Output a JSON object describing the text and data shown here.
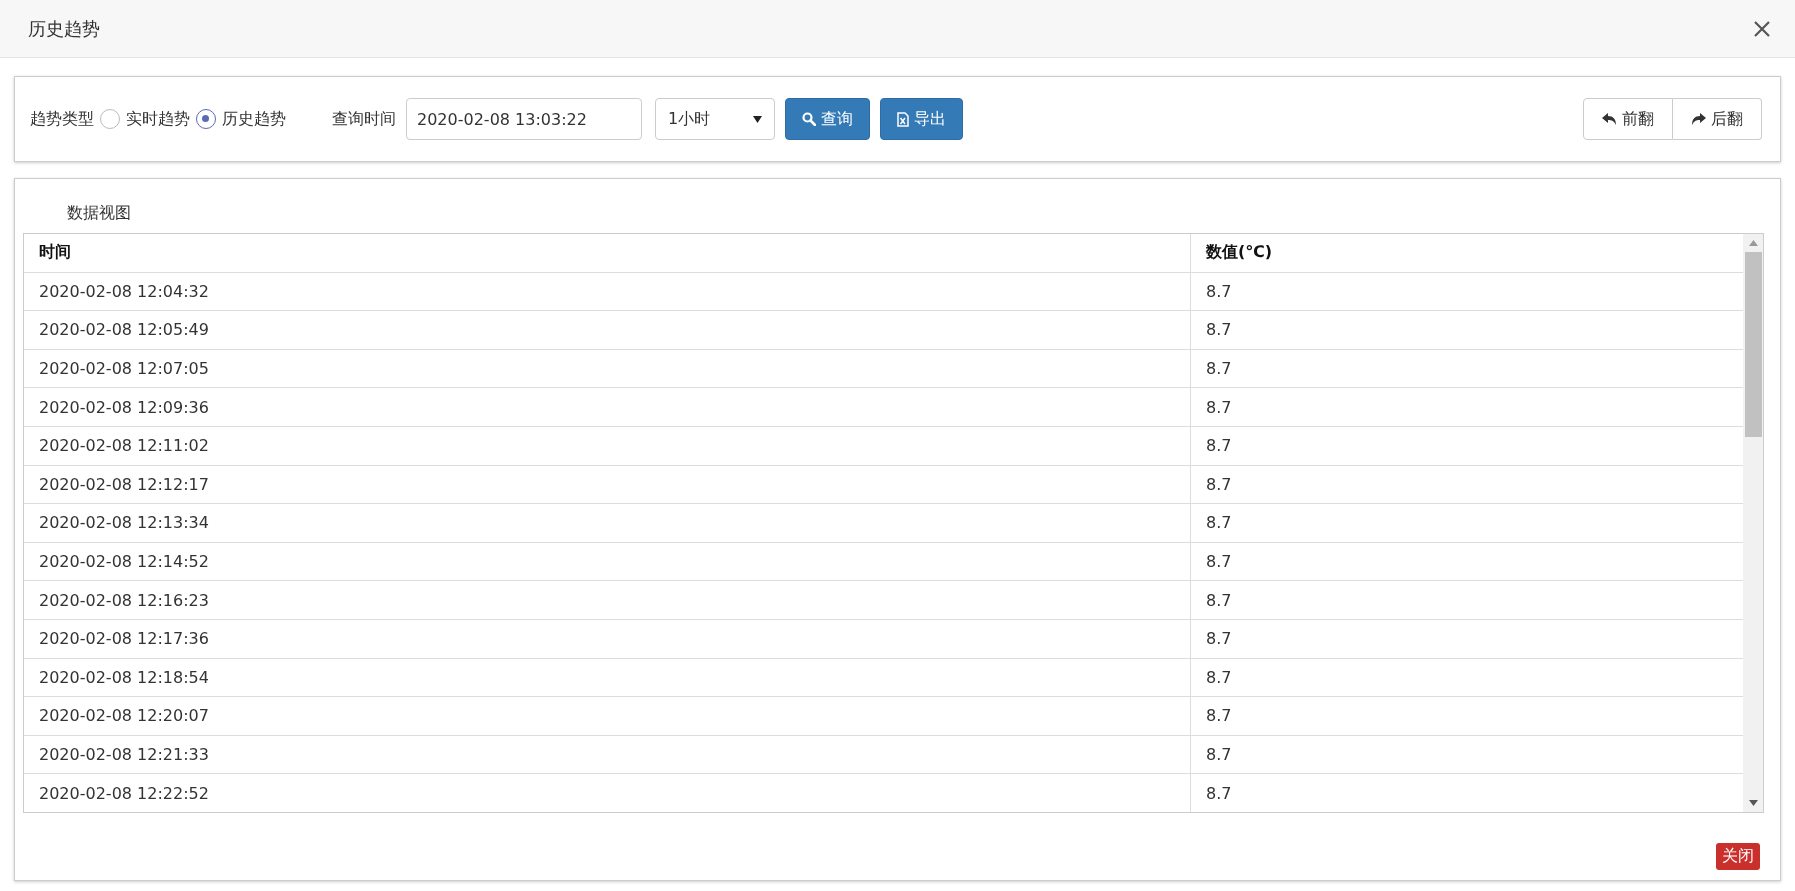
{
  "window": {
    "title": "历史趋势"
  },
  "toolbar": {
    "trend_type_label": "趋势类型",
    "trend_types": [
      {
        "label": "实时趋势",
        "selected": false
      },
      {
        "label": "历史趋势",
        "selected": true
      }
    ],
    "query_time_label": "查询时间",
    "query_time": "2020-02-08 13:03:22",
    "range": "1小时",
    "query_button": "查询",
    "export_button": "导出",
    "prev_button": "前翻",
    "next_button": "后翻"
  },
  "data_view": {
    "title": "数据视图",
    "columns": [
      "时间",
      "数值(℃)"
    ],
    "rows": [
      [
        "2020-02-08 12:04:32",
        "8.7"
      ],
      [
        "2020-02-08 12:05:49",
        "8.7"
      ],
      [
        "2020-02-08 12:07:05",
        "8.7"
      ],
      [
        "2020-02-08 12:09:36",
        "8.7"
      ],
      [
        "2020-02-08 12:11:02",
        "8.7"
      ],
      [
        "2020-02-08 12:12:17",
        "8.7"
      ],
      [
        "2020-02-08 12:13:34",
        "8.7"
      ],
      [
        "2020-02-08 12:14:52",
        "8.7"
      ],
      [
        "2020-02-08 12:16:23",
        "8.7"
      ],
      [
        "2020-02-08 12:17:36",
        "8.7"
      ],
      [
        "2020-02-08 12:18:54",
        "8.7"
      ],
      [
        "2020-02-08 12:20:07",
        "8.7"
      ],
      [
        "2020-02-08 12:21:33",
        "8.7"
      ],
      [
        "2020-02-08 12:22:52",
        "8.7"
      ]
    ]
  },
  "close_button": "关闭"
}
